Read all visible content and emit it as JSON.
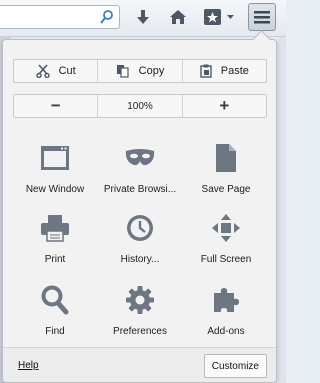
{
  "toolbar": {
    "search_icon": "search-icon",
    "download_icon": "download-arrow-icon",
    "home_icon": "home-icon",
    "bookmarks_icon": "bookmark-star-icon",
    "menu_icon": "hamburger-menu-icon"
  },
  "edit_row": {
    "cut": "Cut",
    "copy": "Copy",
    "paste": "Paste"
  },
  "zoom_row": {
    "zoom_out": "−",
    "zoom_level": "100%",
    "zoom_in": "+"
  },
  "items": [
    {
      "label": "New Window",
      "icon": "new-window-icon"
    },
    {
      "label": "Private Browsi...",
      "icon": "mask-icon"
    },
    {
      "label": "Save Page",
      "icon": "page-icon"
    },
    {
      "label": "Print",
      "icon": "printer-icon"
    },
    {
      "label": "History...",
      "icon": "clock-icon"
    },
    {
      "label": "Full Screen",
      "icon": "fullscreen-icon"
    },
    {
      "label": "Find",
      "icon": "magnifier-icon"
    },
    {
      "label": "Preferences",
      "icon": "gear-icon"
    },
    {
      "label": "Add-ons",
      "icon": "puzzle-icon"
    }
  ],
  "footer": {
    "help": "Help",
    "customize": "Customize"
  },
  "colors": {
    "icon_gray": "#6d7683",
    "panel_bg": "#f2f2f2"
  }
}
